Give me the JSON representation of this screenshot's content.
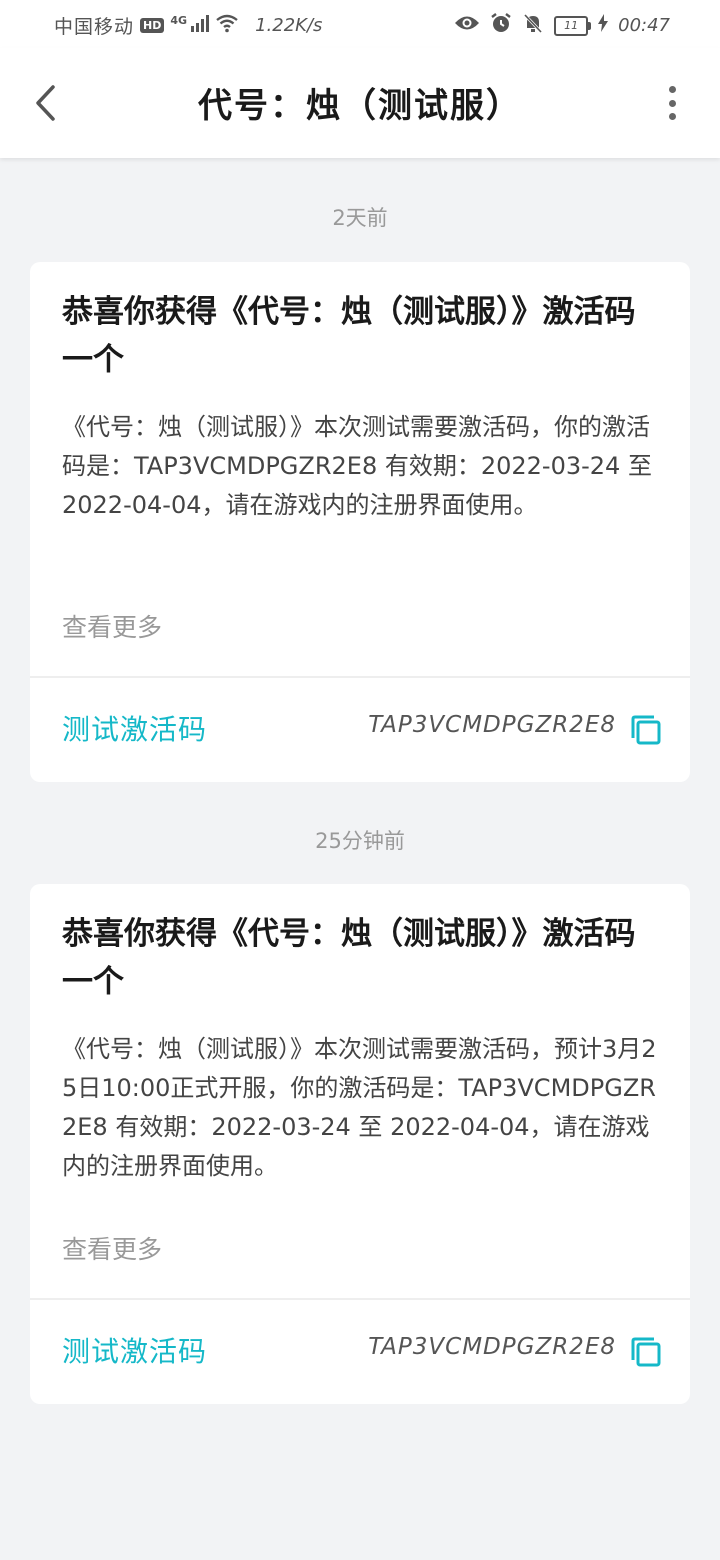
{
  "status_bar": {
    "carrier": "中国移动",
    "hd": "HD",
    "network": "4G",
    "speed": "1.22K/s",
    "battery": "11",
    "time": "00:47"
  },
  "header": {
    "title": "代号：烛（测试服）"
  },
  "messages": [
    {
      "timestamp": "2天前",
      "title": "恭喜你获得《代号：烛（测试服）》激活码一个",
      "body": "《代号：烛（测试服）》本次测试需要激活码，你的激活码是：TAP3VCMDPGZR2E8 有效期：2022-03-24 至 2022-04-04，请在游戏内的注册界面使用。",
      "see_more": "查看更多",
      "footer_label": "测试激活码",
      "code": "TAP3VCMDPGZR2E8"
    },
    {
      "timestamp": "25分钟前",
      "title": "恭喜你获得《代号：烛（测试服）》激活码一个",
      "body": "《代号：烛（测试服）》本次测试需要激活码，预计3月25日10:00正式开服，你的激活码是：TAP3VCMDPGZR2E8 有效期：2022-03-24 至 2022-04-04，请在游戏内的注册界面使用。",
      "see_more": "查看更多",
      "footer_label": "测试激活码",
      "code": "TAP3VCMDPGZR2E8"
    }
  ],
  "colors": {
    "accent": "#15b8c8",
    "background": "#f2f3f5",
    "card": "#ffffff"
  },
  "icons": [
    "back-arrow-icon",
    "more-vertical-icon",
    "copy-icon",
    "eye-icon",
    "alarm-icon",
    "bell-muted-icon",
    "wifi-icon",
    "signal-icon",
    "charging-icon"
  ]
}
